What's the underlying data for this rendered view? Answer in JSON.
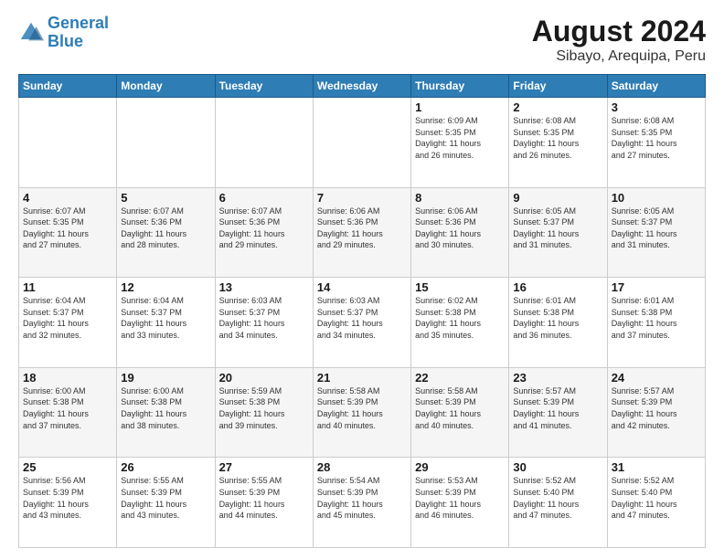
{
  "logo": {
    "line1": "General",
    "line2": "Blue"
  },
  "title": "August 2024",
  "subtitle": "Sibayo, Arequipa, Peru",
  "days_of_week": [
    "Sunday",
    "Monday",
    "Tuesday",
    "Wednesday",
    "Thursday",
    "Friday",
    "Saturday"
  ],
  "weeks": [
    [
      {
        "day": "",
        "info": ""
      },
      {
        "day": "",
        "info": ""
      },
      {
        "day": "",
        "info": ""
      },
      {
        "day": "",
        "info": ""
      },
      {
        "day": "1",
        "info": "Sunrise: 6:09 AM\nSunset: 5:35 PM\nDaylight: 11 hours\nand 26 minutes."
      },
      {
        "day": "2",
        "info": "Sunrise: 6:08 AM\nSunset: 5:35 PM\nDaylight: 11 hours\nand 26 minutes."
      },
      {
        "day": "3",
        "info": "Sunrise: 6:08 AM\nSunset: 5:35 PM\nDaylight: 11 hours\nand 27 minutes."
      }
    ],
    [
      {
        "day": "4",
        "info": "Sunrise: 6:07 AM\nSunset: 5:35 PM\nDaylight: 11 hours\nand 27 minutes."
      },
      {
        "day": "5",
        "info": "Sunrise: 6:07 AM\nSunset: 5:36 PM\nDaylight: 11 hours\nand 28 minutes."
      },
      {
        "day": "6",
        "info": "Sunrise: 6:07 AM\nSunset: 5:36 PM\nDaylight: 11 hours\nand 29 minutes."
      },
      {
        "day": "7",
        "info": "Sunrise: 6:06 AM\nSunset: 5:36 PM\nDaylight: 11 hours\nand 29 minutes."
      },
      {
        "day": "8",
        "info": "Sunrise: 6:06 AM\nSunset: 5:36 PM\nDaylight: 11 hours\nand 30 minutes."
      },
      {
        "day": "9",
        "info": "Sunrise: 6:05 AM\nSunset: 5:37 PM\nDaylight: 11 hours\nand 31 minutes."
      },
      {
        "day": "10",
        "info": "Sunrise: 6:05 AM\nSunset: 5:37 PM\nDaylight: 11 hours\nand 31 minutes."
      }
    ],
    [
      {
        "day": "11",
        "info": "Sunrise: 6:04 AM\nSunset: 5:37 PM\nDaylight: 11 hours\nand 32 minutes."
      },
      {
        "day": "12",
        "info": "Sunrise: 6:04 AM\nSunset: 5:37 PM\nDaylight: 11 hours\nand 33 minutes."
      },
      {
        "day": "13",
        "info": "Sunrise: 6:03 AM\nSunset: 5:37 PM\nDaylight: 11 hours\nand 34 minutes."
      },
      {
        "day": "14",
        "info": "Sunrise: 6:03 AM\nSunset: 5:37 PM\nDaylight: 11 hours\nand 34 minutes."
      },
      {
        "day": "15",
        "info": "Sunrise: 6:02 AM\nSunset: 5:38 PM\nDaylight: 11 hours\nand 35 minutes."
      },
      {
        "day": "16",
        "info": "Sunrise: 6:01 AM\nSunset: 5:38 PM\nDaylight: 11 hours\nand 36 minutes."
      },
      {
        "day": "17",
        "info": "Sunrise: 6:01 AM\nSunset: 5:38 PM\nDaylight: 11 hours\nand 37 minutes."
      }
    ],
    [
      {
        "day": "18",
        "info": "Sunrise: 6:00 AM\nSunset: 5:38 PM\nDaylight: 11 hours\nand 37 minutes."
      },
      {
        "day": "19",
        "info": "Sunrise: 6:00 AM\nSunset: 5:38 PM\nDaylight: 11 hours\nand 38 minutes."
      },
      {
        "day": "20",
        "info": "Sunrise: 5:59 AM\nSunset: 5:38 PM\nDaylight: 11 hours\nand 39 minutes."
      },
      {
        "day": "21",
        "info": "Sunrise: 5:58 AM\nSunset: 5:39 PM\nDaylight: 11 hours\nand 40 minutes."
      },
      {
        "day": "22",
        "info": "Sunrise: 5:58 AM\nSunset: 5:39 PM\nDaylight: 11 hours\nand 40 minutes."
      },
      {
        "day": "23",
        "info": "Sunrise: 5:57 AM\nSunset: 5:39 PM\nDaylight: 11 hours\nand 41 minutes."
      },
      {
        "day": "24",
        "info": "Sunrise: 5:57 AM\nSunset: 5:39 PM\nDaylight: 11 hours\nand 42 minutes."
      }
    ],
    [
      {
        "day": "25",
        "info": "Sunrise: 5:56 AM\nSunset: 5:39 PM\nDaylight: 11 hours\nand 43 minutes."
      },
      {
        "day": "26",
        "info": "Sunrise: 5:55 AM\nSunset: 5:39 PM\nDaylight: 11 hours\nand 43 minutes."
      },
      {
        "day": "27",
        "info": "Sunrise: 5:55 AM\nSunset: 5:39 PM\nDaylight: 11 hours\nand 44 minutes."
      },
      {
        "day": "28",
        "info": "Sunrise: 5:54 AM\nSunset: 5:39 PM\nDaylight: 11 hours\nand 45 minutes."
      },
      {
        "day": "29",
        "info": "Sunrise: 5:53 AM\nSunset: 5:39 PM\nDaylight: 11 hours\nand 46 minutes."
      },
      {
        "day": "30",
        "info": "Sunrise: 5:52 AM\nSunset: 5:40 PM\nDaylight: 11 hours\nand 47 minutes."
      },
      {
        "day": "31",
        "info": "Sunrise: 5:52 AM\nSunset: 5:40 PM\nDaylight: 11 hours\nand 47 minutes."
      }
    ]
  ]
}
